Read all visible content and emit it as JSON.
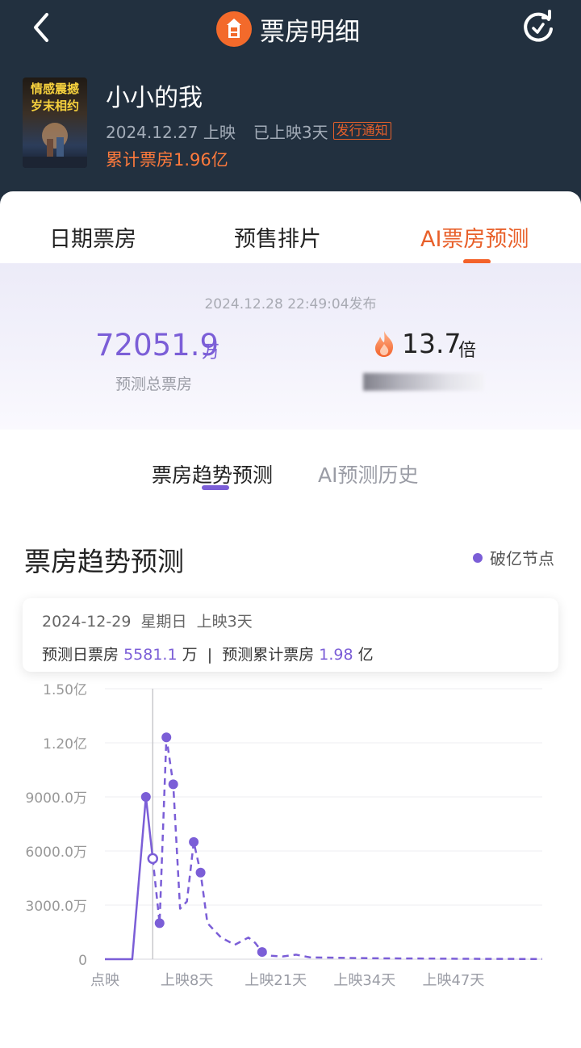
{
  "header": {
    "title": "票房明细",
    "icons": [
      "back-arrow-icon",
      "app-logo-icon",
      "refresh-icon"
    ]
  },
  "movie": {
    "poster_text": "情感震撼岁末相约",
    "name": "小小的我",
    "release_date": "2024.12.27 上映",
    "release_days": "已上映3天",
    "notice_badge": "发行通知",
    "cumulative": "累计票房1.96亿"
  },
  "tabs": [
    {
      "label": "日期票房",
      "active": false
    },
    {
      "label": "预售排片",
      "active": false
    },
    {
      "label": "AI票房预测",
      "active": true
    }
  ],
  "forecast": {
    "publish_time": "2024.12.28 22:49:04发布",
    "total_value": "72051.9",
    "total_unit": "万",
    "total_label": "预测总票房",
    "multiple_value": "13.7",
    "multiple_unit": "倍"
  },
  "subtabs": [
    {
      "label": "票房趋势预测",
      "active": true
    },
    {
      "label": "AI预测历史",
      "active": false
    }
  ],
  "section": {
    "title": "票房趋势预测",
    "legend": "破亿节点"
  },
  "tooltip": {
    "date": "2024-12-29",
    "weekday": "星期日",
    "days": "上映3天",
    "daily_label": "预测日票房",
    "daily_value": "5581.1",
    "daily_unit": "万",
    "separator": "|",
    "cum_label": "预测累计票房",
    "cum_value": "1.98",
    "cum_unit": "亿"
  },
  "colors": {
    "accent": "#7b5ed7",
    "orange": "#f3622a",
    "header_bg": "#22303f"
  },
  "chart_data": {
    "type": "line",
    "x_unit": "day",
    "y_unit": "万",
    "ylim": [
      0,
      15000
    ],
    "y_ticks": [
      {
        "value": 0,
        "label": "0"
      },
      {
        "value": 3000,
        "label": "3000.0万"
      },
      {
        "value": 6000,
        "label": "6000.0万"
      },
      {
        "value": 9000,
        "label": "9000.0万"
      },
      {
        "value": 12000,
        "label": "1.20亿"
      },
      {
        "value": 15000,
        "label": "1.50亿"
      }
    ],
    "x_ticks": [
      {
        "day": -4,
        "label": "点映"
      },
      {
        "day": 8,
        "label": "上映8天"
      },
      {
        "day": 21,
        "label": "上映21天"
      },
      {
        "day": 34,
        "label": "上映34天"
      },
      {
        "day": 47,
        "label": "上映47天"
      }
    ],
    "x_range": [
      -4,
      60
    ],
    "actual": [
      {
        "day": -4,
        "value": 0
      },
      {
        "day": -3,
        "value": 0
      },
      {
        "day": -2,
        "value": 0
      },
      {
        "day": -1,
        "value": 0
      },
      {
        "day": 0,
        "value": 0
      },
      {
        "day": 2,
        "value": 9000
      },
      {
        "day": 3,
        "value": 5581.1
      }
    ],
    "forecast": [
      {
        "day": 3,
        "value": 5581.1
      },
      {
        "day": 4,
        "value": 2000
      },
      {
        "day": 5,
        "value": 12300
      },
      {
        "day": 6,
        "value": 9700
      },
      {
        "day": 7,
        "value": 2800
      },
      {
        "day": 8,
        "value": 3200
      },
      {
        "day": 9,
        "value": 6500
      },
      {
        "day": 10,
        "value": 4800
      },
      {
        "day": 11,
        "value": 2000
      },
      {
        "day": 12,
        "value": 1600
      },
      {
        "day": 13,
        "value": 1200
      },
      {
        "day": 15,
        "value": 800
      },
      {
        "day": 17,
        "value": 1200
      },
      {
        "day": 18,
        "value": 900
      },
      {
        "day": 19,
        "value": 400
      },
      {
        "day": 20,
        "value": 200
      },
      {
        "day": 22,
        "value": 150
      },
      {
        "day": 24,
        "value": 250
      },
      {
        "day": 26,
        "value": 100
      },
      {
        "day": 30,
        "value": 80
      },
      {
        "day": 35,
        "value": 50
      },
      {
        "day": 40,
        "value": 40
      },
      {
        "day": 50,
        "value": 20
      },
      {
        "day": 60,
        "value": 10
      }
    ],
    "markers": [
      {
        "day": 2,
        "value": 9000
      },
      {
        "day": 4,
        "value": 2000
      },
      {
        "day": 5,
        "value": 12300
      },
      {
        "day": 6,
        "value": 9700
      },
      {
        "day": 9,
        "value": 6500
      },
      {
        "day": 10,
        "value": 4800
      },
      {
        "day": 19,
        "value": 400
      }
    ],
    "selected": {
      "day": 3,
      "value": 5581.1
    }
  }
}
